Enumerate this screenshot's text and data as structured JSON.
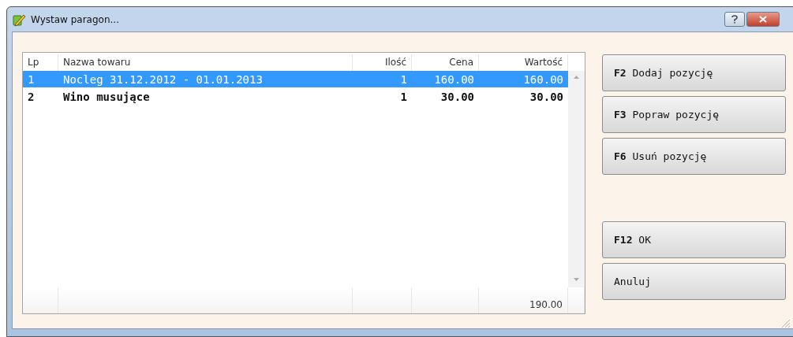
{
  "window": {
    "title": "Wystaw paragon..."
  },
  "table": {
    "columns": [
      "Lp",
      "Nazwa towaru",
      "Ilość",
      "Cena",
      "Wartość"
    ],
    "rows": [
      {
        "selected": true,
        "cells": [
          "1",
          "Nocleg 31.12.2012 - 01.01.2013",
          "1",
          "160.00",
          "160.00"
        ]
      },
      {
        "selected": false,
        "cells": [
          "2",
          "Wino musujące",
          "1",
          "30.00",
          "30.00"
        ]
      }
    ],
    "total": "190.00"
  },
  "buttons": [
    "**F2** Dodaj pozycję",
    "**F3** Popraw pozycję",
    "**F6** Usuń pozycję",
    "**F12** OK",
    "Anuluj"
  ]
}
